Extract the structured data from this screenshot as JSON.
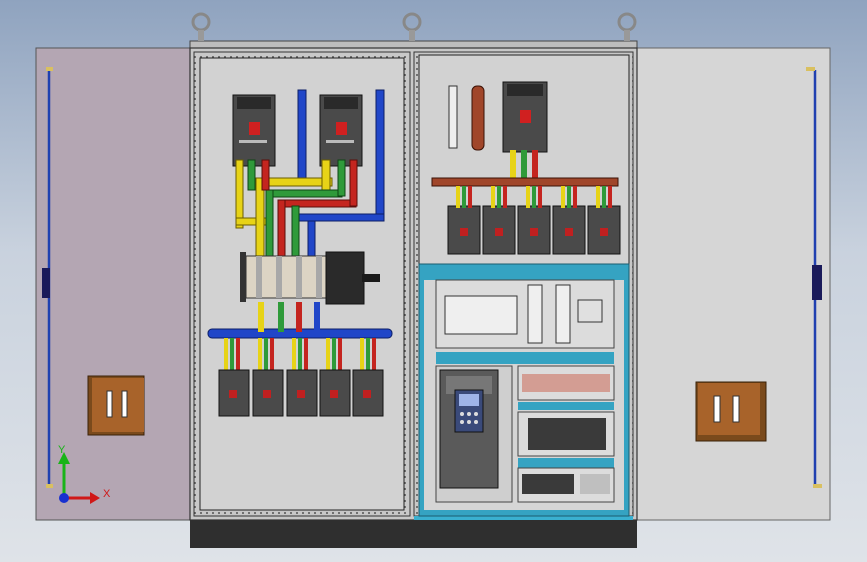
{
  "scene": {
    "background_top": "#8fa3bf",
    "background_bottom": "#dfe3e8",
    "door_left_color": "#b4a6b3",
    "door_right_color": "#d6d6d6",
    "cabinet_color": "#c8c8c8",
    "plinth_color": "#2f2f2f"
  },
  "busbar_colors": {
    "yellow": "#e7d317",
    "green": "#2f9a3a",
    "red": "#c4251f",
    "blue": "#2046c8",
    "copper": "#a0462a"
  },
  "panel_accent": "#35a3c2",
  "triad": {
    "x_label": "X",
    "y_label": "Y",
    "x_color": "#d01818",
    "y_color": "#18b418",
    "z_color": "#1830d0"
  },
  "icons": {
    "lifting_eye": "ring-icon",
    "door_handle": "handle-icon",
    "hinge": "hinge-icon"
  }
}
